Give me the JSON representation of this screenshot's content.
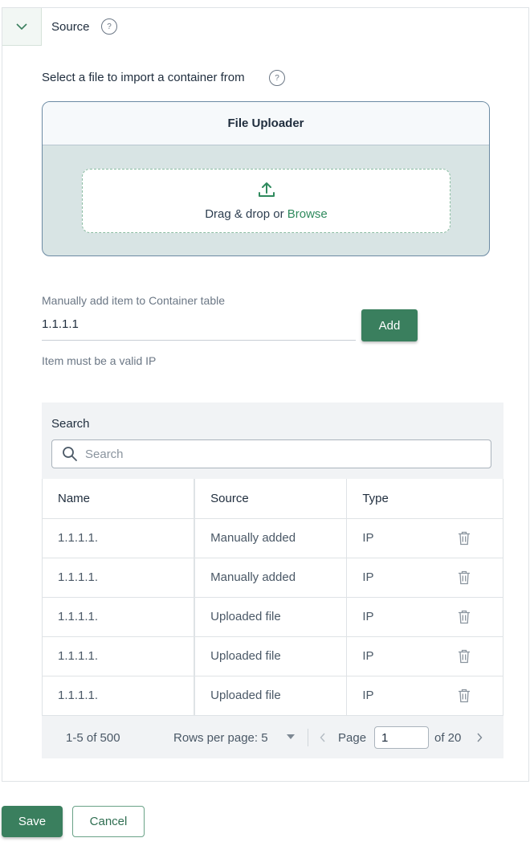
{
  "section": {
    "title": "Source",
    "help_glyph": "?"
  },
  "import": {
    "label": "Select a file to import a container from",
    "help_glyph": "?"
  },
  "uploader": {
    "title": "File Uploader",
    "drop_text": "Drag & drop or ",
    "browse_label": "Browse"
  },
  "manual": {
    "label": "Manually add item to Container table",
    "value": "1.1.1.1",
    "hint": "Item must be a valid IP",
    "add_label": "Add"
  },
  "search": {
    "label": "Search",
    "placeholder": "Search"
  },
  "table": {
    "columns": [
      "Name",
      "Source",
      "Type"
    ],
    "rows": [
      {
        "name": "1.1.1.1.",
        "source": "Manually added",
        "type": "IP"
      },
      {
        "name": "1.1.1.1.",
        "source": "Manually added",
        "type": "IP"
      },
      {
        "name": "1.1.1.1.",
        "source": "Uploaded file",
        "type": "IP"
      },
      {
        "name": "1.1.1.1.",
        "source": "Uploaded file",
        "type": "IP"
      },
      {
        "name": "1.1.1.1.",
        "source": "Uploaded file",
        "type": "IP"
      }
    ]
  },
  "pagination": {
    "range": "1-5 of 500",
    "rows_per_page": "Rows per page: 5",
    "page_label": "Page",
    "page_value": "1",
    "of_label": "of 20"
  },
  "footer": {
    "save_label": "Save",
    "cancel_label": "Cancel"
  },
  "colors": {
    "primary": "#3a7f5e",
    "uploader_bg": "#d8e4e4",
    "link": "#2f8a5d"
  },
  "icons": [
    "chevron-down-icon",
    "help-icon",
    "upload-icon",
    "search-icon",
    "trash-icon",
    "caret-down-icon",
    "chevron-left-icon",
    "chevron-right-icon"
  ]
}
